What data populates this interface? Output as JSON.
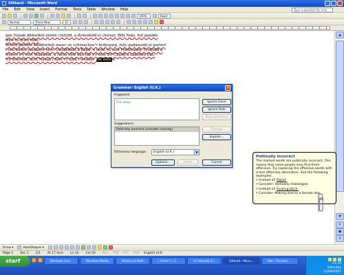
{
  "window": {
    "title": "Slithard - Microsoft Word"
  },
  "menu": {
    "items": [
      "File",
      "Edit",
      "View",
      "Insert",
      "Format",
      "Tools",
      "Table",
      "Window",
      "Help"
    ],
    "help_placeholder": "Type a question for help"
  },
  "toolbar": {
    "style": "Normal",
    "font": "Times New Roman",
    "size": "12",
    "zoom": "100%",
    "read": "Read"
  },
  "document": {
    "lines": [
      "gan Nanak  dddordeb niewn crefydd, a dywedodd ei chwaer, Bibi Naki, fod gandde",
      "Duw tu fewn iddo.",
      "Roedd ganddo ddiddordeb mawr yn cyfrinachau'r bydysawd, felly gadawodd ei gartref",
      "i ymchwilio amdanyn nhw. Gwelddodd â Kabir, a oedd yn sant Hindwaidd. Proffodd a",
      "frenwr o'r enw Sulaikhai, a cafon nhw dau fab o'r enw Sri Chand a Lakshmi Das."
    ],
    "last_line_prefix": "Un diwrnod, aeth Nanak i lawr i'r afon i weddïo. ",
    "selected_text": "Fat men.",
    "after_selection": "A"
  },
  "grammar_dialog": {
    "title": "Grammar: English (U.K.)",
    "fragment_label": "Fragment:",
    "fragment_text": "Fat men.",
    "suggestions_label": "Suggestions:",
    "suggestion": "Politically incorrect (consider revising)",
    "dictionary_label": "Dictionary language:",
    "dictionary_value": "English (U.K.)",
    "buttons": {
      "ignore_once": "Ignore Once",
      "ignore_rule": "Ignore Rule",
      "next_sentence": "Next Sentence",
      "change": "Change",
      "explain": "Explain...",
      "options": "Options...",
      "undo": "Undo",
      "cancel": "Cancel"
    }
  },
  "assistant_balloon": {
    "title": "Politically incorrect",
    "body": "The marked words are politically incorrect. This means that some people may find them offensive. Try replacing the offensive words with a less offensive alternative. See the following examples:",
    "ex1_instead_label": "Instead of:",
    "ex1_instead_word": "Dwarf.",
    "ex1_consider": "Consider: Vertically challenged.",
    "ex2_instead_label": "Instead of:",
    "ex2_instead_word": "Fucking bitch.",
    "ex2_consider": "Consider: Making love to a female dog."
  },
  "drawing_toolbar": {
    "draw": "Draw ▾",
    "autoshapes": "AutoShapes ▾"
  },
  "status_bar": {
    "page": "Page 1",
    "sec": "Sec 1",
    "page_of": "1/1",
    "at": "At 17.4cm",
    "ln": "Ln 32",
    "col": "Col 50",
    "modes": [
      "REC",
      "TRK",
      "EXT",
      "OVR"
    ],
    "language": "English (U.K"
  },
  "taskbar": {
    "start": "start",
    "tasks": [
      "Windows Live ...",
      "Windows Media...",
      "History of Sikhi...",
      "[ *asha* ] - C...",
      "(L) Hannah (L) ...",
      "Sak - Convers...",
      "Slithard - Micro..."
    ],
    "active_task_index": 6,
    "clock_time": "21:10",
    "clock_day": "Saturday",
    "clock_date": "23/06/2007"
  }
}
